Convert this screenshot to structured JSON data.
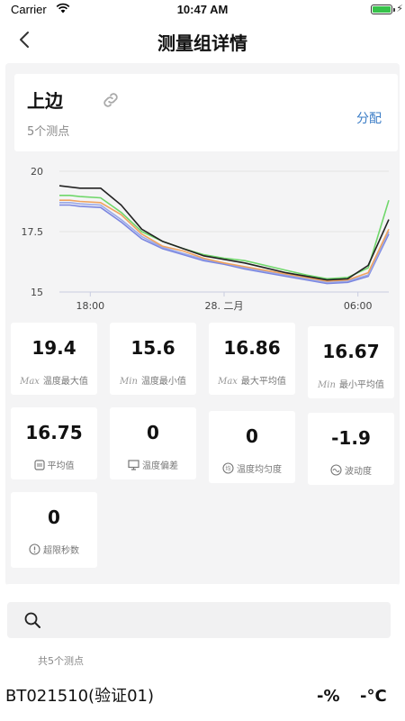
{
  "status_bar": {
    "carrier": "Carrier",
    "time": "10:47 AM"
  },
  "nav": {
    "title": "测量组详情"
  },
  "group": {
    "name": "上边",
    "point_count": "5个测点",
    "assign_label": "分配"
  },
  "chart_data": {
    "type": "line",
    "x_tick_labels": [
      "18:00",
      "28. 二月",
      "06:00"
    ],
    "y_tick_labels": [
      "20",
      "17.5",
      "15"
    ],
    "ylim": [
      15,
      20
    ],
    "grid": true,
    "legend": "none",
    "x": [
      0,
      0.5,
      1,
      2,
      3,
      4,
      5,
      6,
      7,
      8,
      9,
      10,
      11,
      12,
      13,
      14,
      15,
      16
    ],
    "series": [
      {
        "color": "#222222",
        "values": [
          19.4,
          19.35,
          19.3,
          19.3,
          18.6,
          17.6,
          17.1,
          16.8,
          16.5,
          16.35,
          16.2,
          16.0,
          15.8,
          15.65,
          15.5,
          15.55,
          16.1,
          18.0
        ]
      },
      {
        "color": "#6fd76a",
        "values": [
          19.0,
          19.0,
          18.95,
          18.9,
          18.3,
          17.5,
          17.1,
          16.8,
          16.55,
          16.4,
          16.3,
          16.1,
          15.9,
          15.7,
          15.55,
          15.6,
          16.0,
          18.8
        ]
      },
      {
        "color": "#f0a35e",
        "values": [
          18.8,
          18.8,
          18.75,
          18.7,
          18.2,
          17.4,
          16.9,
          16.7,
          16.4,
          16.2,
          16.05,
          15.9,
          15.75,
          15.6,
          15.45,
          15.5,
          15.8,
          17.6
        ]
      },
      {
        "color": "#9aa8e8",
        "values": [
          18.7,
          18.7,
          18.65,
          18.6,
          18.0,
          17.3,
          16.85,
          16.6,
          16.35,
          16.2,
          16.0,
          15.85,
          15.7,
          15.55,
          15.4,
          15.45,
          15.7,
          17.5
        ]
      },
      {
        "color": "#7b86e0",
        "values": [
          18.6,
          18.6,
          18.55,
          18.5,
          17.9,
          17.2,
          16.8,
          16.55,
          16.3,
          16.15,
          15.95,
          15.8,
          15.65,
          15.5,
          15.35,
          15.4,
          15.65,
          17.4
        ]
      }
    ]
  },
  "stats": [
    {
      "value": "19.4",
      "prefix": "Max",
      "label": "温度最大值",
      "icon": "max-text-icon"
    },
    {
      "value": "15.6",
      "prefix": "Min",
      "label": "温度最小值",
      "icon": "min-text-icon"
    },
    {
      "value": "16.86",
      "prefix": "Max",
      "label": "最大平均值",
      "icon": "max-text-icon"
    },
    {
      "value": "16.67",
      "prefix": "Min",
      "label": "最小平均值",
      "icon": "min-text-icon"
    },
    {
      "value": "16.75",
      "label": "平均值",
      "icon": "average-icon"
    },
    {
      "value": "0",
      "label": "温度偏差",
      "icon": "monitor-icon"
    },
    {
      "value": "0",
      "label": "温度均匀度",
      "icon": "uniformity-icon"
    },
    {
      "value": "-1.9",
      "label": "波动度",
      "icon": "wave-icon"
    },
    {
      "value": "0",
      "label": "超限秒数",
      "icon": "alert-icon"
    }
  ],
  "list": {
    "search_placeholder": "",
    "count_text": "共5个测点",
    "sensors": [
      {
        "name": "BT021510(验证01)",
        "humidity": "-%",
        "temperature": "-°C"
      }
    ]
  }
}
